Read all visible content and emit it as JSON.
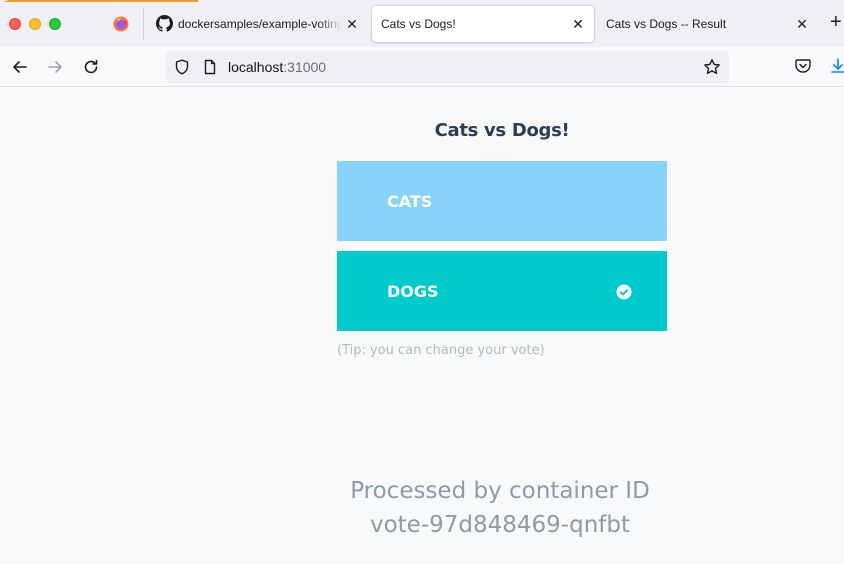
{
  "browser": {
    "tabs": [
      {
        "label": "dockersamples/example-voting-app",
        "icon": "github-icon"
      },
      {
        "label": "Cats vs Dogs!",
        "active": true
      },
      {
        "label": "Cats vs Dogs -- Result"
      }
    ],
    "close_glyph": "✕",
    "newtab_glyph": "+",
    "url": {
      "host": "localhost",
      "port": ":31000"
    }
  },
  "page": {
    "title": "Cats vs Dogs!",
    "options": [
      {
        "label": "CATS",
        "color": "#89d2f9",
        "selected": false
      },
      {
        "label": "DOGS",
        "color": "#00cbca",
        "selected": true
      }
    ],
    "tip": "(Tip: you can change your vote)",
    "processed_line1": "Processed by container ID",
    "processed_line2": "vote-97d848469-qnfbt"
  }
}
